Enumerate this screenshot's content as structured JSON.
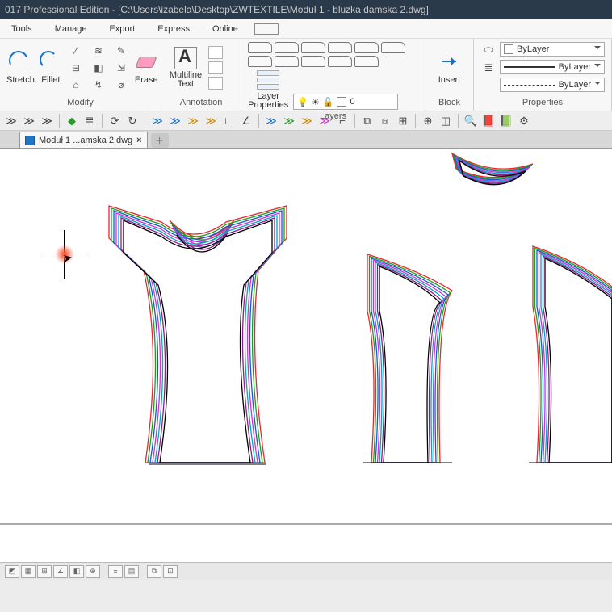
{
  "title": "017 Professional Edition - [C:\\Users\\izabela\\Desktop\\ZWTEXTILE\\Moduł 1 - bluzka damska 2.dwg]",
  "menu": {
    "tools": "Tools",
    "manage": "Manage",
    "export": "Export",
    "express": "Express",
    "online": "Online"
  },
  "ribbon": {
    "modify": {
      "label": "Modify",
      "stretch": "Stretch",
      "fillet": "Fillet",
      "erase": "Erase"
    },
    "annotation": {
      "label": "Annotation",
      "mtext": "Multiline\nText"
    },
    "layers": {
      "label": "Layers",
      "lprop": "Layer\nProperties",
      "active": "0"
    },
    "block": {
      "label": "Block",
      "insert": "Insert"
    },
    "properties": {
      "label": "Properties",
      "bylayer": "ByLayer"
    }
  },
  "tab": {
    "name": "Moduł 1 ...amska 2.dwg"
  },
  "pattern_colors": [
    "#e9262f",
    "#1aa01a",
    "#1857d6",
    "#d033d0",
    "#00a6c8",
    "#8e1d8e",
    "#000000"
  ]
}
